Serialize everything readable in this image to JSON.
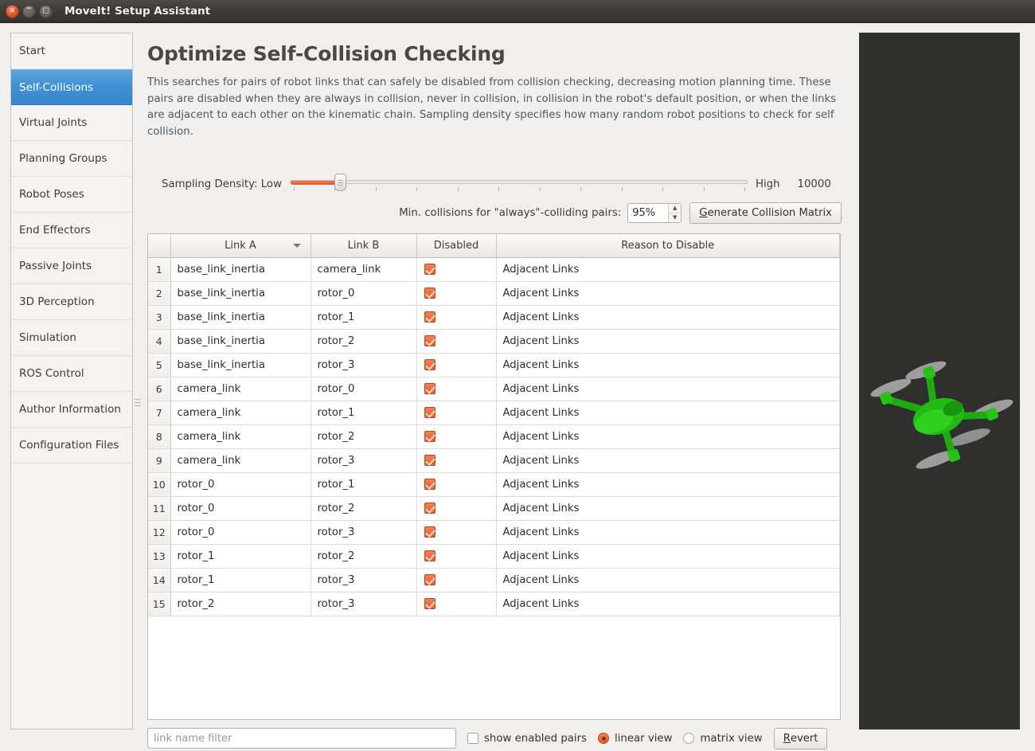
{
  "window": {
    "title": "MoveIt! Setup Assistant",
    "buttons": {
      "close": "×",
      "minimize": "−",
      "maximize": "□"
    }
  },
  "sidebar": {
    "items": [
      {
        "label": "Start",
        "selected": false
      },
      {
        "label": "Self-Collisions",
        "selected": true
      },
      {
        "label": "Virtual Joints",
        "selected": false
      },
      {
        "label": "Planning Groups",
        "selected": false
      },
      {
        "label": "Robot Poses",
        "selected": false
      },
      {
        "label": "End Effectors",
        "selected": false
      },
      {
        "label": "Passive Joints",
        "selected": false
      },
      {
        "label": "3D Perception",
        "selected": false
      },
      {
        "label": "Simulation",
        "selected": false
      },
      {
        "label": "ROS Control",
        "selected": false
      },
      {
        "label": "Author Information",
        "selected": false
      },
      {
        "label": "Configuration Files",
        "selected": false
      }
    ]
  },
  "main": {
    "title": "Optimize Self-Collision Checking",
    "description": "This searches for pairs of robot links that can safely be disabled from collision checking, decreasing motion planning time. These pairs are disabled when they are always in collision, never in collision, in collision in the robot's default position, or when the links are adjacent to each other on the kinematic chain. Sampling density specifies how many random robot positions to check for self collision."
  },
  "density": {
    "label": "Sampling Density: Low",
    "high_label": "High",
    "value": "10000",
    "slider_percent": 10
  },
  "mincollisions": {
    "label": "Min. collisions for \"always\"-colliding pairs:",
    "value": "95%",
    "up_arrow": "▲",
    "down_arrow": "▼",
    "generate_button": "Generate Collision Matrix",
    "generate_button_mnemonic": "G",
    "generate_button_rest": "enerate Collision Matrix"
  },
  "table": {
    "columns": [
      "",
      "Link A",
      "Link B",
      "Disabled",
      "Reason to Disable"
    ],
    "sorted_column": "Link A",
    "sort_direction": "descending",
    "rows": [
      {
        "n": "1",
        "link_a": "base_link_inertia",
        "link_b": "camera_link",
        "disabled": true,
        "reason": "Adjacent Links"
      },
      {
        "n": "2",
        "link_a": "base_link_inertia",
        "link_b": "rotor_0",
        "disabled": true,
        "reason": "Adjacent Links"
      },
      {
        "n": "3",
        "link_a": "base_link_inertia",
        "link_b": "rotor_1",
        "disabled": true,
        "reason": "Adjacent Links"
      },
      {
        "n": "4",
        "link_a": "base_link_inertia",
        "link_b": "rotor_2",
        "disabled": true,
        "reason": "Adjacent Links"
      },
      {
        "n": "5",
        "link_a": "base_link_inertia",
        "link_b": "rotor_3",
        "disabled": true,
        "reason": "Adjacent Links"
      },
      {
        "n": "6",
        "link_a": "camera_link",
        "link_b": "rotor_0",
        "disabled": true,
        "reason": "Adjacent Links"
      },
      {
        "n": "7",
        "link_a": "camera_link",
        "link_b": "rotor_1",
        "disabled": true,
        "reason": "Adjacent Links"
      },
      {
        "n": "8",
        "link_a": "camera_link",
        "link_b": "rotor_2",
        "disabled": true,
        "reason": "Adjacent Links"
      },
      {
        "n": "9",
        "link_a": "camera_link",
        "link_b": "rotor_3",
        "disabled": true,
        "reason": "Adjacent Links"
      },
      {
        "n": "10",
        "link_a": "rotor_0",
        "link_b": "rotor_1",
        "disabled": true,
        "reason": "Adjacent Links"
      },
      {
        "n": "11",
        "link_a": "rotor_0",
        "link_b": "rotor_2",
        "disabled": true,
        "reason": "Adjacent Links"
      },
      {
        "n": "12",
        "link_a": "rotor_0",
        "link_b": "rotor_3",
        "disabled": true,
        "reason": "Adjacent Links"
      },
      {
        "n": "13",
        "link_a": "rotor_1",
        "link_b": "rotor_2",
        "disabled": true,
        "reason": "Adjacent Links"
      },
      {
        "n": "14",
        "link_a": "rotor_1",
        "link_b": "rotor_3",
        "disabled": true,
        "reason": "Adjacent Links"
      },
      {
        "n": "15",
        "link_a": "rotor_2",
        "link_b": "rotor_3",
        "disabled": true,
        "reason": "Adjacent Links"
      }
    ]
  },
  "bottom": {
    "filter_placeholder": "link name filter",
    "filter_value": "",
    "show_enabled_label": "show enabled pairs",
    "show_enabled_checked": false,
    "linear_view_label": "linear view",
    "linear_view_checked": true,
    "matrix_view_label": "matrix view",
    "matrix_view_checked": false,
    "revert_button": "Revert",
    "revert_mnemonic": "R",
    "revert_rest": "evert"
  },
  "viewport": {
    "background_color": "#2f2f2e",
    "robot_color": "#22b714",
    "rotor_color": "#9e9e9e",
    "model": "quadcopter-drone"
  },
  "colors": {
    "accent_orange": "#e4622c",
    "selection_blue": "#3f8fd0",
    "titlebar": "#3c3b38"
  }
}
